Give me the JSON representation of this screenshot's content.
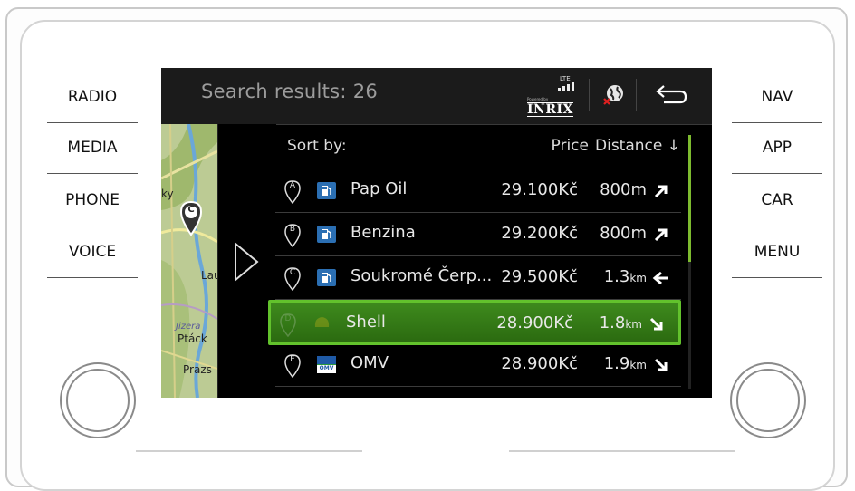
{
  "hardware_buttons": {
    "left": [
      "RADIO",
      "MEDIA",
      "PHONE",
      "VOICE"
    ],
    "right": [
      "NAV",
      "APP",
      "CAR",
      "MENU"
    ]
  },
  "header": {
    "title": "Search results: 26",
    "signal_label": "LTE",
    "inrix_powered": "Powered by",
    "inrix_logo": "INRIX",
    "online_icon": "globe-offline-icon",
    "back_icon": "back-arrow-icon"
  },
  "map_labels": [
    "ky",
    "Lau",
    "Jizera",
    "Ptáck",
    "Prazs"
  ],
  "map_pin_label": "C",
  "sort": {
    "label": "Sort by:",
    "price": "Price",
    "distance": "Distance ↓"
  },
  "results": [
    {
      "letter": "A",
      "fuel_icon": "fuel-station-icon",
      "name": "Pap Oil",
      "price": "29.100Kč",
      "distance": "800m",
      "unit": "",
      "direction": "north-east",
      "selected": false
    },
    {
      "letter": "B",
      "fuel_icon": "fuel-station-icon",
      "name": "Benzina",
      "price": "29.200Kč",
      "distance": "800m",
      "unit": "",
      "direction": "north-east",
      "selected": false
    },
    {
      "letter": "C",
      "fuel_icon": "fuel-station-icon",
      "name": "Soukromé Čerp...",
      "price": "29.500Kč",
      "distance": "1.3",
      "unit": "km",
      "direction": "west",
      "selected": false
    },
    {
      "letter": "D",
      "fuel_icon": "shell-logo-icon",
      "name": "Shell",
      "price": "28.900Kč",
      "distance": "1.8",
      "unit": "km",
      "direction": "south-east",
      "selected": true
    },
    {
      "letter": "E",
      "fuel_icon": "omv-logo-icon",
      "omv_text": "OMV",
      "name": "OMV",
      "price": "28.900Kč",
      "distance": "1.9",
      "unit": "km",
      "direction": "south-east",
      "selected": false
    }
  ],
  "colors": {
    "selected_fill": "#3e8a1d",
    "selected_border": "#62c22c",
    "scroll_thumb": "#7dbb2f",
    "screen_bg": "#000000"
  }
}
